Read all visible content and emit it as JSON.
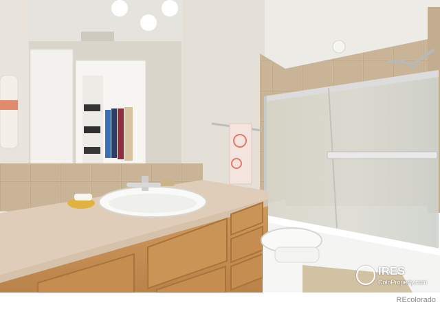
{
  "photo": {
    "alt": "Bathroom with vanity, mirror reflecting a closet, toilet and glass shower door",
    "colors": {
      "wall": "#e9e5dc",
      "ceiling": "#ecebe6",
      "tile": "#cbb89c",
      "counter": "#e0cdb9",
      "cabinet": "#c48e52",
      "glass": "#d7d8cf",
      "porcelain": "#f7f7f7"
    }
  },
  "watermark": {
    "brand": "IRES",
    "site": "ColoProperty.com"
  },
  "footer": {
    "credit": "REcolorado"
  }
}
